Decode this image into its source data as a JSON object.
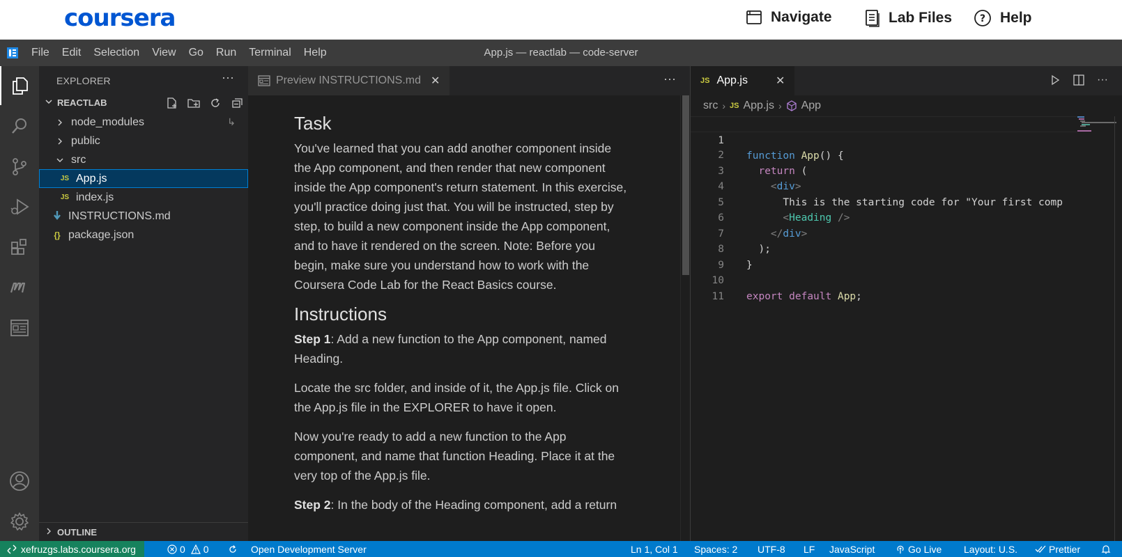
{
  "coursera": {
    "logo": "coursera",
    "nav": [
      {
        "label": "Navigate",
        "icon": "navigate-icon"
      },
      {
        "label": "Lab Files",
        "icon": "lab-files-icon"
      },
      {
        "label": "Help",
        "icon": "help-icon"
      }
    ]
  },
  "menubar": {
    "items": [
      "File",
      "Edit",
      "Selection",
      "View",
      "Go",
      "Run",
      "Terminal",
      "Help"
    ],
    "window_title": "App.js — reactlab — code-server"
  },
  "activitybar": {
    "icons": [
      "explorer-icon",
      "search-icon",
      "source-control-icon",
      "run-debug-icon",
      "extensions-icon",
      "markdown-icon",
      "preview-icon",
      "account-icon",
      "settings-gear-icon"
    ]
  },
  "sidebar": {
    "title": "EXPLORER",
    "section": "REACTLAB",
    "tree": [
      {
        "label": "node_modules",
        "type": "folder",
        "expanded": false
      },
      {
        "label": "public",
        "type": "folder",
        "expanded": false
      },
      {
        "label": "src",
        "type": "folder",
        "expanded": true
      },
      {
        "label": "App.js",
        "type": "js",
        "selected": true
      },
      {
        "label": "index.js",
        "type": "js"
      },
      {
        "label": "INSTRUCTIONS.md",
        "type": "md"
      },
      {
        "label": "package.json",
        "type": "json"
      }
    ],
    "outline": "OUTLINE"
  },
  "preview": {
    "tab_label": "Preview INSTRUCTIONS.md",
    "h_task": "Task",
    "p_task": "You've learned that you can add another component inside the App component, and then render that new component inside the App component's return statement. In this exercise, you'll practice doing just that. You will be instructed, step by step, to build a new component inside the App component, and to have it rendered on the screen. Note: Before you begin, make sure you understand how to work with the Coursera Code Lab for the React Basics course.",
    "h_instructions": "Instructions",
    "step1_label": "Step 1",
    "step1_text": ": Add a new function to the App component, named Heading.",
    "p_locate": "Locate the src folder, and inside of it, the App.js file. Click on the App.js file in the EXPLORER to have it open.",
    "p_ready": "Now you're ready to add a new function to the App component, and name that function Heading. Place it at the very top of the App.js file.",
    "step2_label": "Step 2",
    "step2_text": ": In the body of the Heading component, add a return"
  },
  "editor": {
    "tab_label": "App.js",
    "breadcrumbs": [
      "src",
      "App.js",
      "App"
    ],
    "lines": [
      {
        "n": "1"
      },
      {
        "n": "2"
      },
      {
        "n": "3"
      },
      {
        "n": "4"
      },
      {
        "n": "5"
      },
      {
        "n": "6"
      },
      {
        "n": "7"
      },
      {
        "n": "8"
      },
      {
        "n": "9"
      },
      {
        "n": "10"
      },
      {
        "n": "11"
      }
    ],
    "code": {
      "l1_kw": "function",
      "l1_fn": "App",
      "l1_rest": "() {",
      "l2_kw": "return",
      "l2_rest": " (",
      "l3_open": "<",
      "l3_tag": "div",
      "l3_close": ">",
      "l4_text": "This is the starting code for \"Your first comp",
      "l5_open": "<",
      "l5_comp": "Heading",
      "l5_close": " />",
      "l6_open": "</",
      "l6_tag": "div",
      "l6_close": ">",
      "l7": ");",
      "l8": "}",
      "l10_kw1": "export",
      "l10_kw2": "default",
      "l10_fn": "App",
      "l10_semi": ";"
    }
  },
  "statusbar": {
    "remote": "xefruzgs.labs.coursera.org",
    "errors": "0",
    "warnings": "0",
    "open_server": "Open Development Server",
    "position": "Ln 1, Col 1",
    "spaces": "Spaces: 2",
    "encoding": "UTF-8",
    "eol": "LF",
    "language": "JavaScript",
    "golive": "Go Live",
    "layout": "Layout: U.S.",
    "prettier": "Prettier"
  },
  "colors": {
    "coursera_blue": "#0056d2",
    "statusbar_blue": "#007acc",
    "remote_green": "#16825d",
    "selection": "#04395e"
  }
}
